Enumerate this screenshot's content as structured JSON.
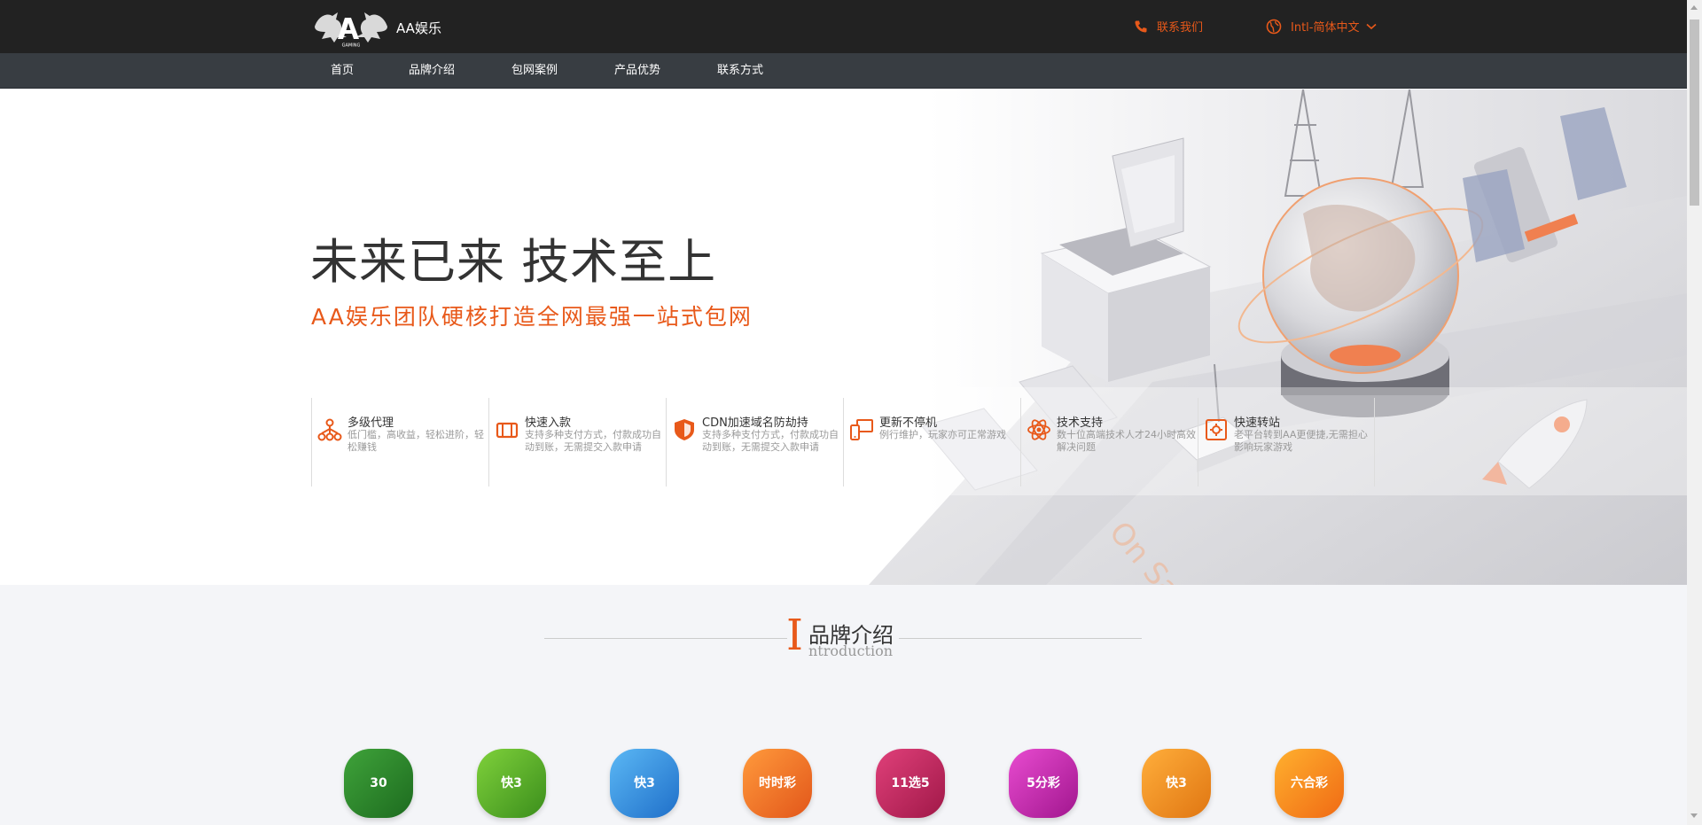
{
  "header": {
    "logo_text": "AA娱乐",
    "contact_label": "联系我们",
    "language_label": "Intl-简体中文"
  },
  "nav": {
    "items": [
      {
        "label": "首页"
      },
      {
        "label": "品牌介绍"
      },
      {
        "label": "包网案例"
      },
      {
        "label": "产品优势"
      },
      {
        "label": "联系方式"
      }
    ]
  },
  "hero": {
    "title": "未来已来 技术至上",
    "subtitle": "AA娱乐团队硬核打造全网最强一站式包网"
  },
  "features": [
    {
      "title": "多级代理",
      "desc": "低门槛，高收益，轻松进阶，轻松赚钱",
      "icon": "agent-tree-icon"
    },
    {
      "title": "快速入款",
      "desc": "支持多种支付方式，付款成功自动到账，无需提交入款申请",
      "icon": "wallet-icon"
    },
    {
      "title": "CDN加速域名防劫持",
      "desc": "支持多种支付方式，付款成功自动到账，无需提交入款申请",
      "icon": "shield-icon"
    },
    {
      "title": "更新不停机",
      "desc": "例行维护，玩家亦可正常游戏",
      "icon": "devices-icon"
    },
    {
      "title": "技术支持",
      "desc": "数十位高端技术人才24小时高效解决问题",
      "icon": "atom-icon"
    },
    {
      "title": "快速转站",
      "desc": "老平台转到AA更便捷,无需担心影响玩家游戏",
      "icon": "transfer-icon"
    }
  ],
  "brand": {
    "initial": "I",
    "title": "品牌介绍",
    "english": "ntroduction"
  },
  "colors": {
    "accent": "#e8591a",
    "topbar": "#222222",
    "navbar": "#383d42"
  }
}
